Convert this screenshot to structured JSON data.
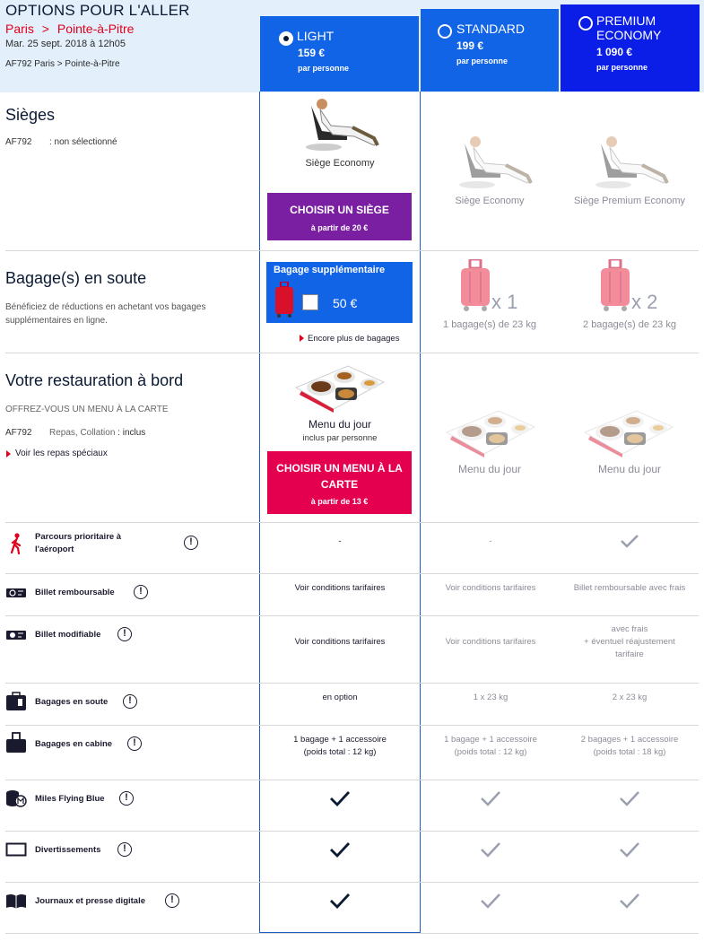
{
  "header": {
    "title": "OPTIONS POUR L'ALLER",
    "route_from": "Paris",
    "route_sep": ">",
    "route_to": "Pointe-à-Pitre",
    "date": "Mar. 25 sept. 2018 à 12h05",
    "flight": "AF792 Paris  >  Pointe-à-Pitre"
  },
  "fares": [
    {
      "name": "LIGHT",
      "price": "159 €",
      "per": "par personne",
      "selected": true
    },
    {
      "name": "STANDARD",
      "price": "199 €",
      "per": "par personne",
      "selected": false
    },
    {
      "name_line1": "PREMIUM",
      "name_line2": "ECONOMY",
      "price": "1 090 €",
      "per": "par personne",
      "selected": false
    }
  ],
  "seats": {
    "title": "Sièges",
    "flight": "AF792",
    "status": ": non sélectionné",
    "light_label": "Siège Economy",
    "standard_label": "Siège Economy",
    "premium_label": "Siège Premium Economy",
    "button_main": "CHOISIR UN SIÈGE",
    "button_sub": "à partir de 20 €"
  },
  "baggage": {
    "title": "Bagage(s) en soute",
    "description": "Bénéficiez de réductions en achetant vos bagages supplémentaires en ligne.",
    "box_title": "Bagage supplémentaire",
    "box_price": "50 €",
    "more_link": "Encore plus de bagages",
    "standard_count": "x 1",
    "standard_label": "1 bagage(s) de 23 kg",
    "premium_count": "x 2",
    "premium_label": "2 bagage(s) de 23 kg"
  },
  "meals": {
    "title": "Votre restauration à bord",
    "offer": "OFFREZ-VOUS UN MENU À LA CARTE",
    "flight": "AF792",
    "meal_types": "Repas, Collation",
    "meal_status_sep": ":",
    "meal_status": "inclus",
    "special_link": "Voir les repas spéciaux",
    "light_label": "Menu du jour",
    "light_sub": "inclus par personne",
    "standard_label": "Menu du jour",
    "premium_label": "Menu du jour",
    "button_main": "CHOISIR UN MENU À LA CARTE",
    "button_sub": "à partir de 13 €"
  },
  "features": [
    {
      "label_line1": "Parcours prioritaire à",
      "label_line2": "l'aéroport",
      "light": "-",
      "standard": "-",
      "premium": "check"
    },
    {
      "label": "Billet remboursable",
      "light": "Voir conditions tarifaires",
      "standard": "Voir conditions tarifaires",
      "premium": "Billet remboursable avec frais"
    },
    {
      "label": "Billet modifiable",
      "light": "Voir conditions tarifaires",
      "standard": "Voir conditions tarifaires",
      "premium_lines": [
        "avec frais",
        "+ éventuel réajustement",
        "tarifaire"
      ]
    },
    {
      "label": "Bagages en soute",
      "light": "en option",
      "standard": "1 x 23 kg",
      "premium": "2 x 23 kg"
    },
    {
      "label": "Bagages en cabine",
      "light_lines": [
        "1 bagage + 1 accessoire",
        "(poids total : 12 kg)"
      ],
      "standard_lines": [
        "1 bagage + 1 accessoire",
        "(poids total : 12 kg)"
      ],
      "premium_lines": [
        "2 bagages + 1 accessoire",
        "(poids total : 18 kg)"
      ]
    },
    {
      "label": "Miles Flying Blue",
      "light": "check",
      "standard": "check",
      "premium": "check"
    },
    {
      "label": "Divertissements",
      "light": "check",
      "standard": "check",
      "premium": "check"
    },
    {
      "label": "Journaux et presse digitale",
      "light": "check",
      "standard": "check",
      "premium": "check"
    }
  ],
  "info_glyph": "!",
  "colors": {
    "brand_blue": "#1264e6",
    "premium_blue": "#0a1ee8",
    "accent_red": "#e2001a",
    "seat_button": "#7a1fa2",
    "meal_button": "#e4004f"
  }
}
